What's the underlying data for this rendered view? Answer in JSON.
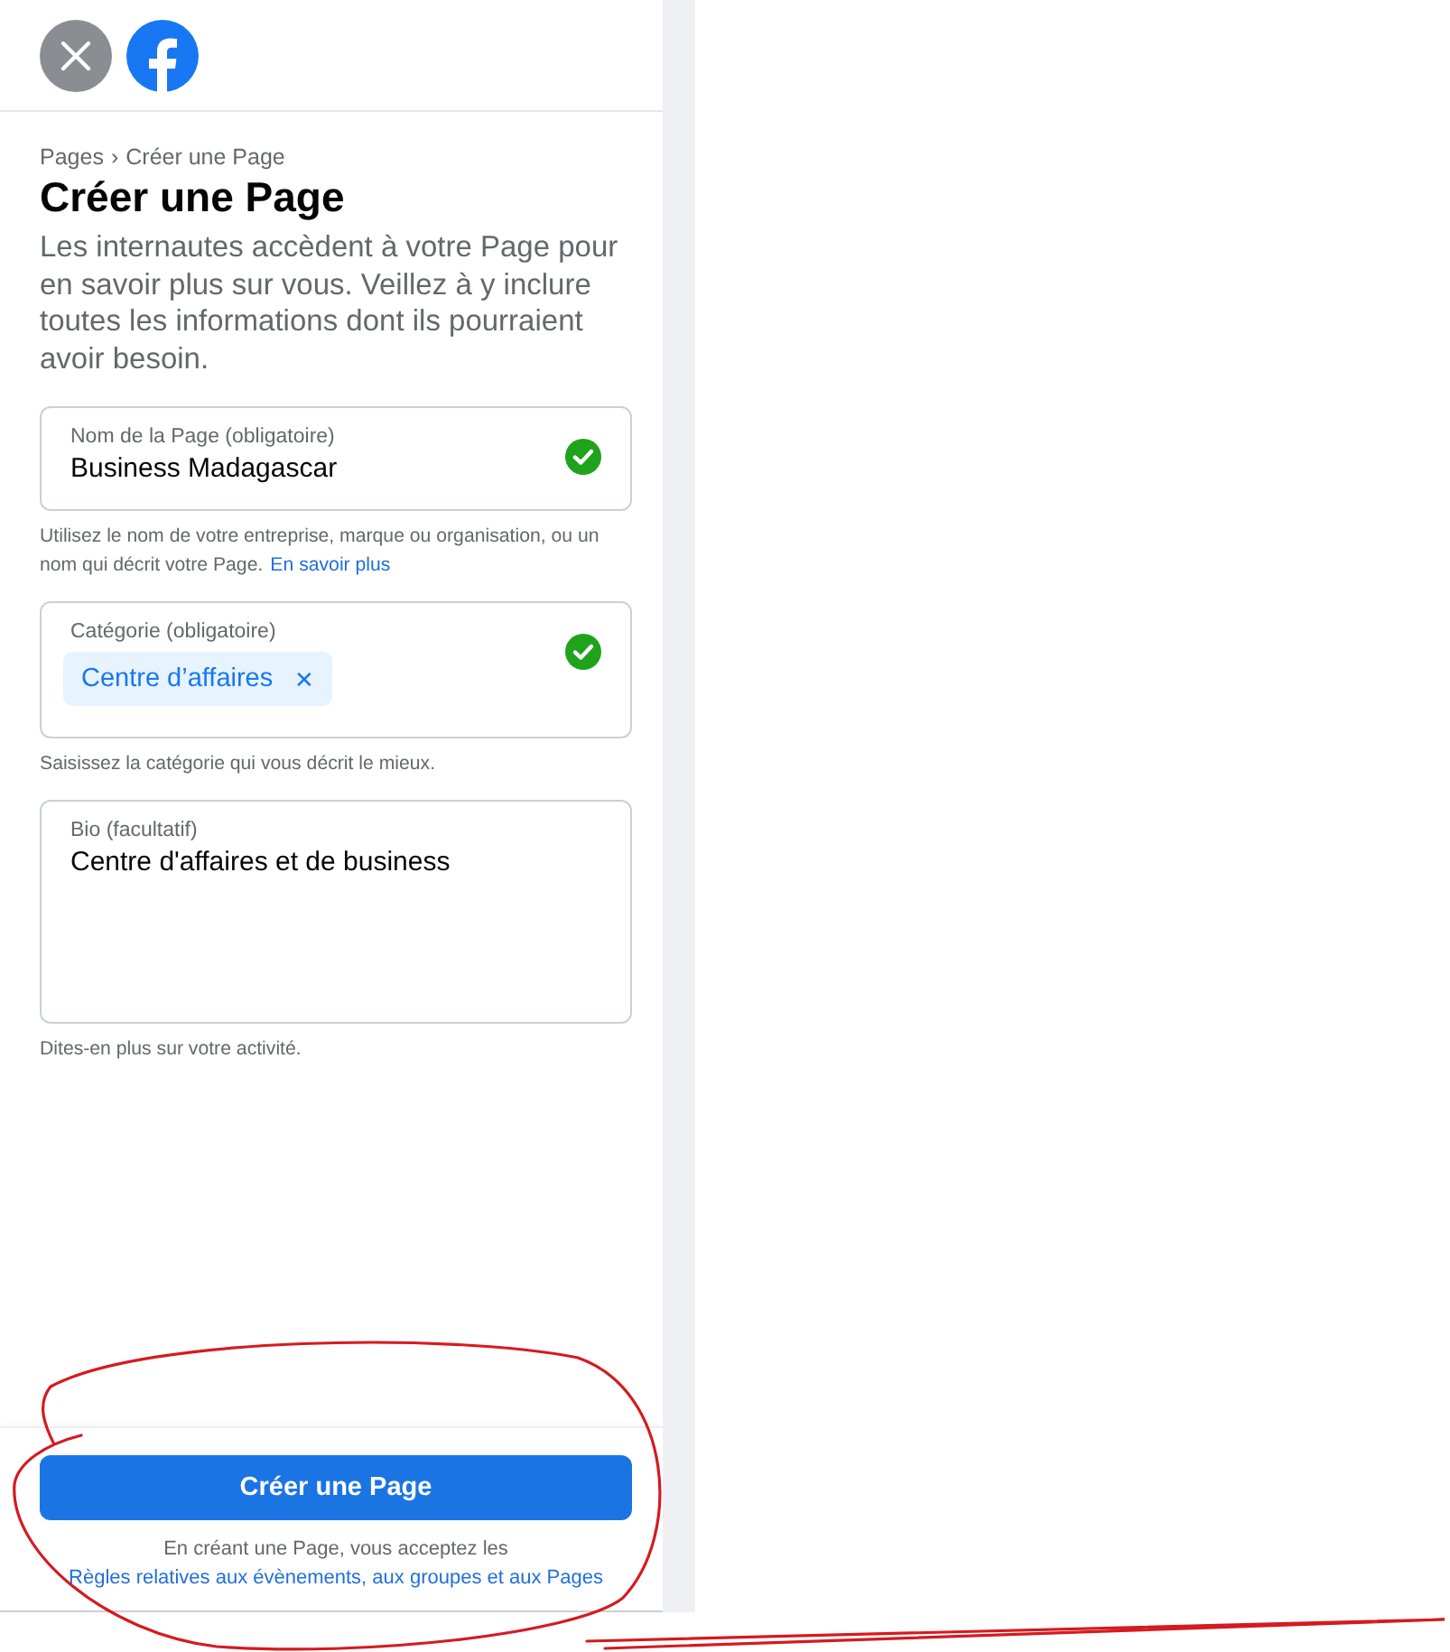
{
  "breadcrumb": [
    {
      "label": "Pages"
    },
    {
      "label": "Créer une Page"
    }
  ],
  "breadcrumb_separator": "›",
  "title": "Créer une Page",
  "description": "Les internautes accèdent à votre Page pour en savoir plus sur vous. Veillez à y inclure toutes les informations dont ils pourraient avoir besoin.",
  "fields": [
    {
      "kind": "text",
      "label": "Nom de la Page (obligatoire)",
      "value": "Business Madagascar",
      "valid": true,
      "help": "Utilisez le nom de votre entreprise, marque ou organisation, ou un nom qui décrit votre Page.",
      "help_link": "En savoir plus"
    },
    {
      "kind": "tags",
      "label": "Catégorie (obligatoire)",
      "tags": [
        {
          "label": "Centre d’affaires",
          "remove": "✕"
        }
      ],
      "valid": true,
      "help": "Saisissez la catégorie qui vous décrit le mieux."
    },
    {
      "kind": "textarea",
      "label": "Bio (facultatif)",
      "value": "Centre d'affaires et de business",
      "valid": false,
      "help": "Dites-en plus sur votre activité."
    }
  ],
  "submit_button": "Créer une Page",
  "terms": {
    "text": "En créant une Page, vous acceptez les",
    "link": "Règles relatives aux évènements, aux groupes et aux Pages"
  }
}
